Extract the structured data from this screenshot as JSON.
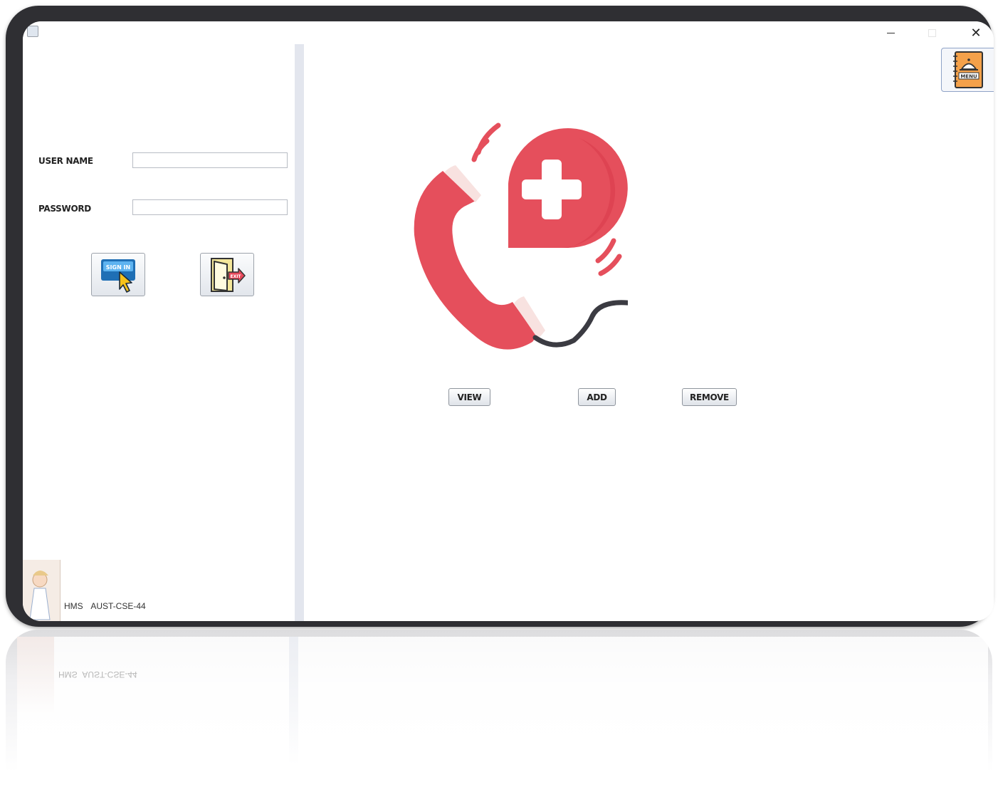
{
  "window": {
    "close_glyph": "✕"
  },
  "login": {
    "username_label": "USER NAME",
    "password_label": "PASSWORD",
    "username_value": "",
    "password_value": "",
    "signin_icon_text": "SIGN IN",
    "exit_icon_text": "EXIT"
  },
  "footer": {
    "app_name": "HMS",
    "course": "AUST-CSE-44"
  },
  "menu": {
    "icon_text": "MENU"
  },
  "actions": {
    "view_label": "VIEW",
    "add_label": "ADD",
    "remove_label": "REMOVE"
  },
  "icons": {
    "app": "app-icon",
    "signin": "sign-in-icon",
    "exit": "exit-door-icon",
    "menu": "menu-book-icon",
    "hero": "medical-call-icon"
  },
  "colors": {
    "accent_red": "#E54F5C",
    "menu_orange": "#F4A14A",
    "signin_blue": "#5DB3F0",
    "frame_dark": "#2F2F33"
  }
}
